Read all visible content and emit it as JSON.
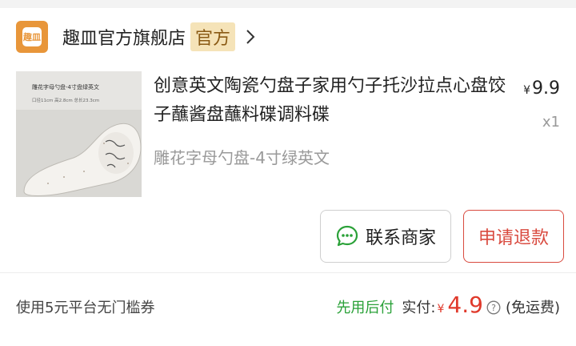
{
  "shop": {
    "logo_text": "趣皿",
    "name": "趣皿官方旗舰店",
    "badge": "官方"
  },
  "product": {
    "title": "创意英文陶瓷勺盘子家用勺子托沙拉点心盘饺子蘸酱盘蘸料碟调料碟",
    "price_symbol": "¥",
    "price": "9.9",
    "quantity": "x1",
    "variant": "雕花字母勺盘-4寸绿英文",
    "image_caption_line1": "雕花字母勺盘-4寸盘绿英文",
    "image_caption_line2": "口径11cm 高2.8cm 总长23.3cm"
  },
  "actions": {
    "contact_label": "联系商家",
    "refund_label": "申请退款"
  },
  "footer": {
    "coupon_text": "使用5元平台无门槛券",
    "pay_later": "先用后付",
    "paid_label": "实付:",
    "currency": "¥",
    "amount": "4.9",
    "shipping_note": "(免运费)"
  },
  "colors": {
    "accent_red": "#e0392b",
    "badge_bg": "#f5e3b8",
    "paylater_green": "#2aa138",
    "logo_orange": "#e8963a"
  },
  "icons": {
    "chevron": "chevron-right-icon",
    "contact": "chat-bubble-icon",
    "help": "question-mark-circle-icon"
  }
}
